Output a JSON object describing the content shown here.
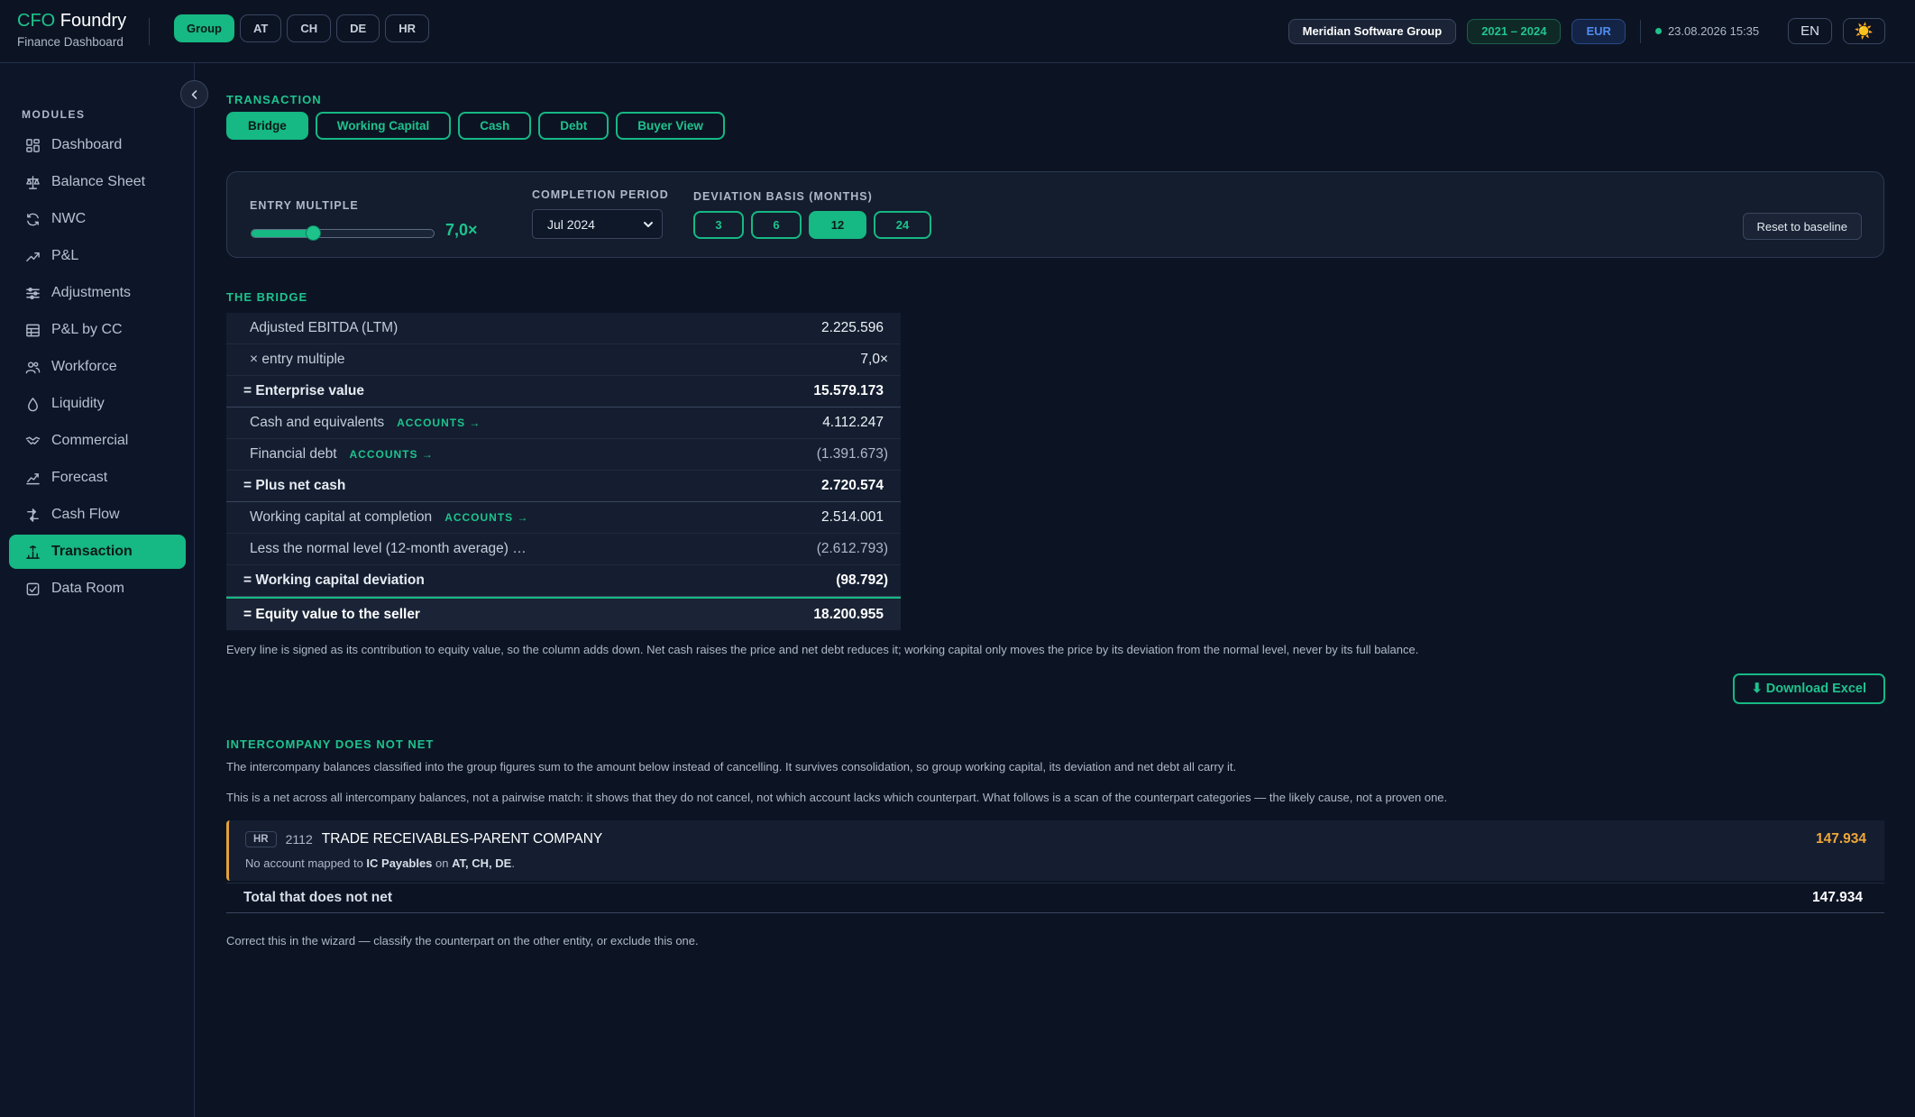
{
  "brand": {
    "name_accent": "CFO",
    "name_rest": "Foundry",
    "subtitle": "Finance Dashboard"
  },
  "entity_tabs": [
    {
      "label": "Group",
      "active": true
    },
    {
      "label": "AT",
      "active": false
    },
    {
      "label": "CH",
      "active": false
    },
    {
      "label": "DE",
      "active": false
    },
    {
      "label": "HR",
      "active": false
    }
  ],
  "header": {
    "company": "Meridian Software Group",
    "years": "2021 – 2024",
    "currency": "EUR",
    "timestamp": "23.08.2026 15:35",
    "language": "EN",
    "theme_icon": "☀️"
  },
  "sidebar": {
    "section_label": "MODULES",
    "items": [
      {
        "label": "Dashboard",
        "icon": "dashboard-icon",
        "active": false
      },
      {
        "label": "Balance Sheet",
        "icon": "scale-icon",
        "active": false
      },
      {
        "label": "NWC",
        "icon": "refresh-icon",
        "active": false
      },
      {
        "label": "P&L",
        "icon": "trend-up-icon",
        "active": false
      },
      {
        "label": "Adjustments",
        "icon": "sliders-icon",
        "active": false
      },
      {
        "label": "P&L by CC",
        "icon": "table-icon",
        "active": false
      },
      {
        "label": "Workforce",
        "icon": "users-icon",
        "active": false
      },
      {
        "label": "Liquidity",
        "icon": "droplet-icon",
        "active": false
      },
      {
        "label": "Commercial",
        "icon": "handshake-icon",
        "active": false
      },
      {
        "label": "Forecast",
        "icon": "forecast-icon",
        "active": false
      },
      {
        "label": "Cash Flow",
        "icon": "cashflow-icon",
        "active": false
      },
      {
        "label": "Transaction",
        "icon": "transaction-icon",
        "active": true
      },
      {
        "label": "Data Room",
        "icon": "data-room-icon",
        "active": false
      }
    ]
  },
  "transaction": {
    "section_label": "TRANSACTION",
    "tabs": [
      {
        "label": "Bridge",
        "active": true
      },
      {
        "label": "Working Capital",
        "active": false
      },
      {
        "label": "Cash",
        "active": false
      },
      {
        "label": "Debt",
        "active": false
      },
      {
        "label": "Buyer View",
        "active": false
      }
    ]
  },
  "controls": {
    "entry_multiple_label": "ENTRY MULTIPLE",
    "entry_multiple_value": "7,0×",
    "entry_multiple_slider_fraction": 0.34,
    "completion_period_label": "COMPLETION PERIOD",
    "completion_period_value": "Jul 2024",
    "deviation_basis_label": "DEVIATION BASIS (MONTHS)",
    "deviation_basis_options": [
      {
        "label": "3",
        "active": false
      },
      {
        "label": "6",
        "active": false
      },
      {
        "label": "12",
        "active": true
      },
      {
        "label": "24",
        "active": false
      }
    ],
    "reset_label": "Reset to baseline"
  },
  "bridge": {
    "section_label": "THE BRIDGE",
    "accounts_link": "ACCOUNTS →",
    "rows": [
      {
        "label": "Adjusted EBITDA (LTM)",
        "value": "2.225.596",
        "type": "line",
        "link": false
      },
      {
        "label": "× entry multiple",
        "value": "7,0×",
        "type": "line",
        "link": false
      },
      {
        "label": "= Enterprise value",
        "value": "15.579.173",
        "type": "total",
        "link": false
      },
      {
        "label": "Cash and equivalents",
        "value": "4.112.247",
        "type": "line",
        "link": true
      },
      {
        "label": "Financial debt",
        "value": "(1.391.673)",
        "type": "line",
        "link": true
      },
      {
        "label": "= Plus net cash",
        "value": "2.720.574",
        "type": "total",
        "link": false
      },
      {
        "label": "Working capital at completion",
        "value": "2.514.001",
        "type": "line",
        "link": true
      },
      {
        "label": "Less the normal level (12-month average) …",
        "value": "(2.612.793)",
        "type": "line",
        "link": false
      },
      {
        "label": "= Working capital deviation",
        "value": "(98.792)",
        "type": "total",
        "link": false
      },
      {
        "label": "= Equity value to the seller",
        "value": "18.200.955",
        "type": "final",
        "link": false
      }
    ],
    "note": "Every line is signed as its contribution to equity value, so the column adds down. Net cash raises the price and net debt reduces it; working capital only moves the price by its deviation from the normal level, never by its full balance.",
    "download_label": "⬇ Download Excel"
  },
  "intercompany": {
    "section_label": "INTERCOMPANY DOES NOT NET",
    "para1": "The intercompany balances classified into the group figures sum to the amount below instead of cancelling. It survives consolidation, so group working capital, its deviation and net debt all carry it.",
    "para2": "This is a net across all intercompany balances, not a pairwise match: it shows that they do not cancel, not which account lacks which counterpart. What follows is a scan of the counterpart categories — the likely cause, not a proven one.",
    "item": {
      "entity": "HR",
      "account": "2112",
      "name": "TRADE RECEIVABLES-PARENT COMPANY",
      "amount": "147.934",
      "detail_prefix": "No account mapped to ",
      "detail_target": "IC Payables",
      "detail_mid": " on ",
      "detail_entities": "AT, CH, DE",
      "detail_suffix": "."
    },
    "total_label": "Total that does not net",
    "total_value": "147.934",
    "footer": "Correct this in the wizard — classify the counterpart on the other entity, or exclude this one."
  },
  "colors": {
    "accent": "#16b883",
    "warning": "#f0a63a",
    "background": "#0c1424"
  }
}
